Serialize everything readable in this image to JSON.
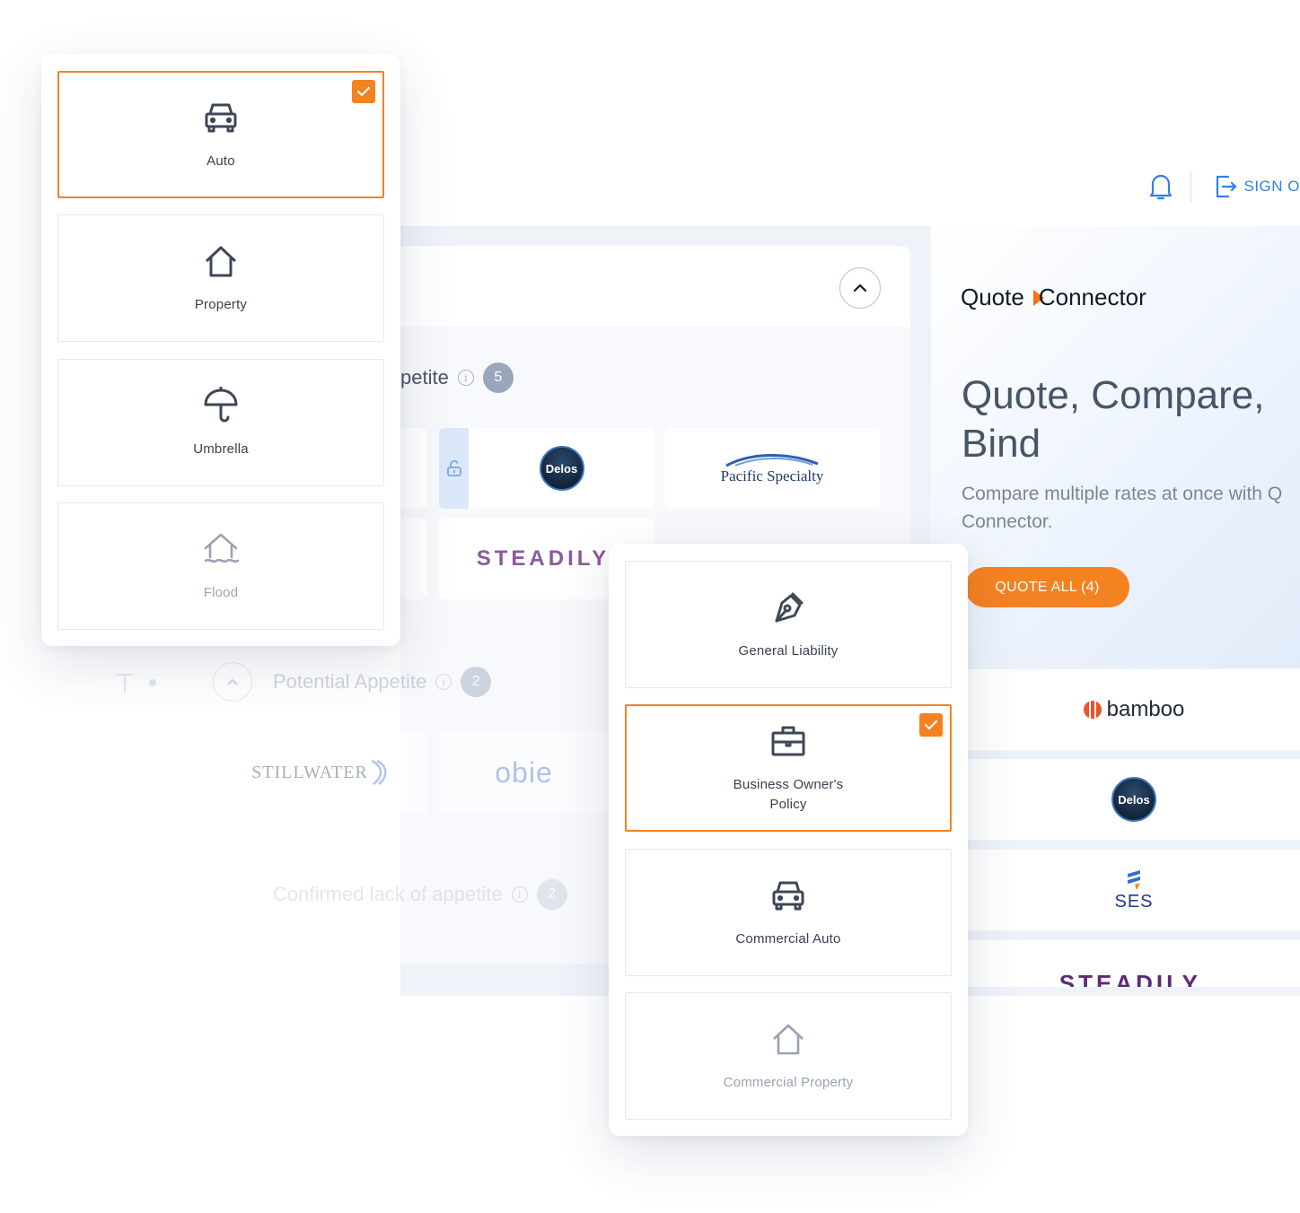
{
  "header": {
    "signout_label": "SIGN O"
  },
  "main": {
    "appetite_title_partial": "petite",
    "appetite_count": "5",
    "carriers": {
      "delos": "Delos",
      "pacific": "Pacific Specialty",
      "steadily": "STEADILY."
    },
    "potential": {
      "title": "Potential Appetite",
      "count": "2",
      "carriers": {
        "stillwater": "STILLWATER",
        "obie": "obie"
      }
    },
    "confirmed_lack": {
      "title": "Confirmed lack of appetite",
      "count": "2"
    }
  },
  "quote_connector": {
    "brand_left": "Quote",
    "brand_right": "Connector",
    "title_line1": "Quote, Compare,",
    "title_line2": "Bind",
    "subtitle_line1": "Compare multiple rates at once with Q",
    "subtitle_line2": "Connector.",
    "quote_all_label": "QUOTE ALL (4)",
    "carriers": [
      "bamboo",
      "Delos",
      "SES",
      "STEADILY."
    ]
  },
  "personal_lines": {
    "tiles": [
      {
        "label": "Auto",
        "icon": "car-icon",
        "selected": true
      },
      {
        "label": "Property",
        "icon": "house-icon",
        "selected": false
      },
      {
        "label": "Umbrella",
        "icon": "umbrella-icon",
        "selected": false
      },
      {
        "label": "Flood",
        "icon": "flood-house-icon",
        "selected": false,
        "disabled": true
      }
    ]
  },
  "commercial_lines": {
    "tiles": [
      {
        "label": "General Liability",
        "icon": "pen-nib-icon",
        "selected": false
      },
      {
        "label_line1": "Business Owner's",
        "label_line2": "Policy",
        "icon": "briefcase-icon",
        "selected": true
      },
      {
        "label": "Commercial Auto",
        "icon": "car-icon",
        "selected": false
      },
      {
        "label": "Commercial Property",
        "icon": "house-icon",
        "selected": false,
        "disabled": true
      }
    ]
  },
  "colors": {
    "accent": "#f58220",
    "link": "#2f80ed",
    "text": "#374151",
    "muted": "#9aa3b1"
  }
}
